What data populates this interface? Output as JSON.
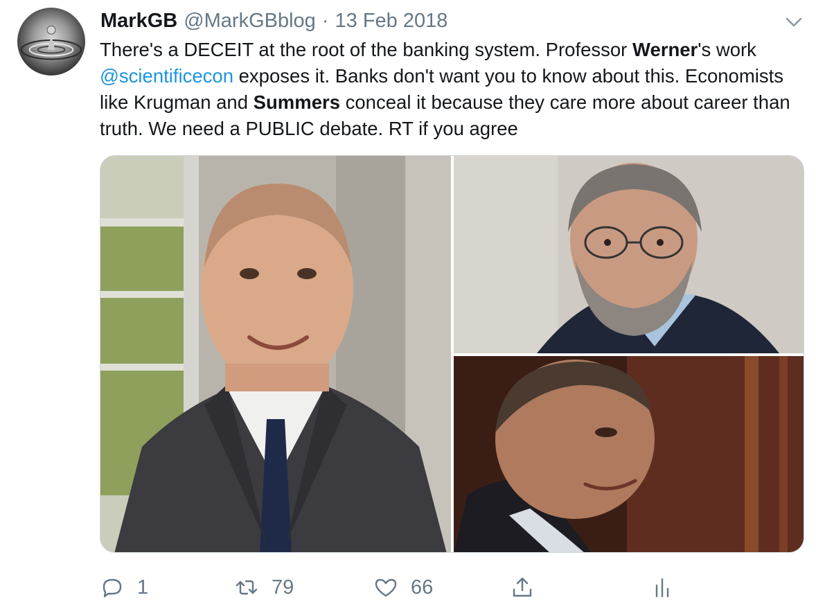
{
  "tweet": {
    "display_name": "MarkGB",
    "handle": "@MarkGBblog",
    "separator": "·",
    "date": "13 Feb 2018",
    "text": {
      "seg1": "There's a DECEIT at the root of the banking system. Professor ",
      "seg2_bold": "Werner",
      "seg3": "'s work ",
      "mention": "@scientificecon",
      "seg4": " exposes it. Banks don't want you to know about this. Economists like Krugman and ",
      "seg5_bold": "Summers",
      "seg6": " conceal it because they care more about career than truth. We need a PUBLIC debate. RT if you agree"
    },
    "media": [
      {
        "name": "photo-man-in-suit"
      },
      {
        "name": "photo-bearded-man-glasses"
      },
      {
        "name": "photo-older-man"
      }
    ],
    "actions": {
      "reply_count": "1",
      "retweet_count": "79",
      "like_count": "66"
    }
  },
  "colors": {
    "text": "#14171a",
    "secondary": "#657786",
    "link": "#1b95e0",
    "border": "#ccd6dd"
  },
  "icons": [
    "reply-icon",
    "retweet-icon",
    "like-icon",
    "share-icon",
    "analytics-icon",
    "chevron-down-icon"
  ]
}
